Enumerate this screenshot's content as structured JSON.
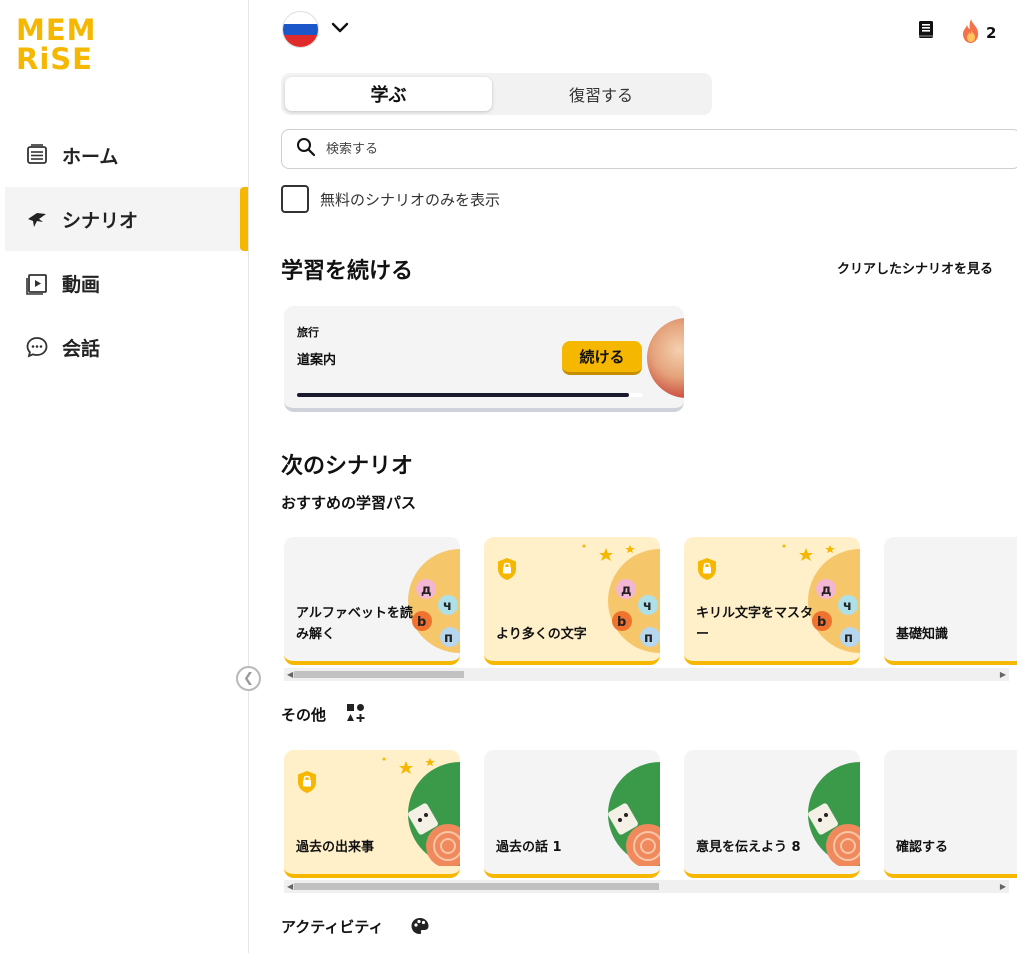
{
  "logo": {
    "line1": "MEM",
    "line2": "RiSE"
  },
  "sidebar": {
    "items": [
      {
        "label": "ホーム",
        "icon": "home-feed-icon"
      },
      {
        "label": "シナリオ",
        "icon": "scenario-icon"
      },
      {
        "label": "動画",
        "icon": "video-icon"
      },
      {
        "label": "会話",
        "icon": "chat-bubble-icon"
      }
    ],
    "active_item": "シナリオ"
  },
  "topbar": {
    "language_flag": "russian-flag",
    "streak_count": "2"
  },
  "tabs": [
    {
      "label": "学ぶ",
      "selected": true
    },
    {
      "label": "復習する",
      "selected": false
    }
  ],
  "search": {
    "placeholder": "検索する"
  },
  "filter": {
    "label": "無料のシナリオのみを表示",
    "checked": false
  },
  "continue_section": {
    "title": "学習を続ける",
    "see_cleared": "クリアしたシナリオを見る",
    "card": {
      "category": "旅行",
      "title": "道案内",
      "button": "続ける",
      "progress": 0.96
    }
  },
  "next_section": {
    "title": "次のシナリオ",
    "recommended_title": "おすすめの学習パス",
    "recommended_cards": [
      {
        "title": "アルファベットを読み解く",
        "locked": false
      },
      {
        "title": "より多くの文字",
        "locked": true
      },
      {
        "title": "キリル文字をマスター",
        "locked": true
      },
      {
        "title": "基礎知識",
        "locked": false
      }
    ],
    "other_title": "その他",
    "other_cards": [
      {
        "title": "過去の出来事",
        "locked": true
      },
      {
        "title": "過去の話 1",
        "locked": false
      },
      {
        "title": "意見を伝えよう 8",
        "locked": false
      },
      {
        "title": "確認する",
        "locked": false
      }
    ],
    "activity_title": "アクティビティ"
  },
  "colors": {
    "brand": "#f5b700",
    "card_gray": "#f4f4f4",
    "card_yellow": "#fff0c9"
  }
}
